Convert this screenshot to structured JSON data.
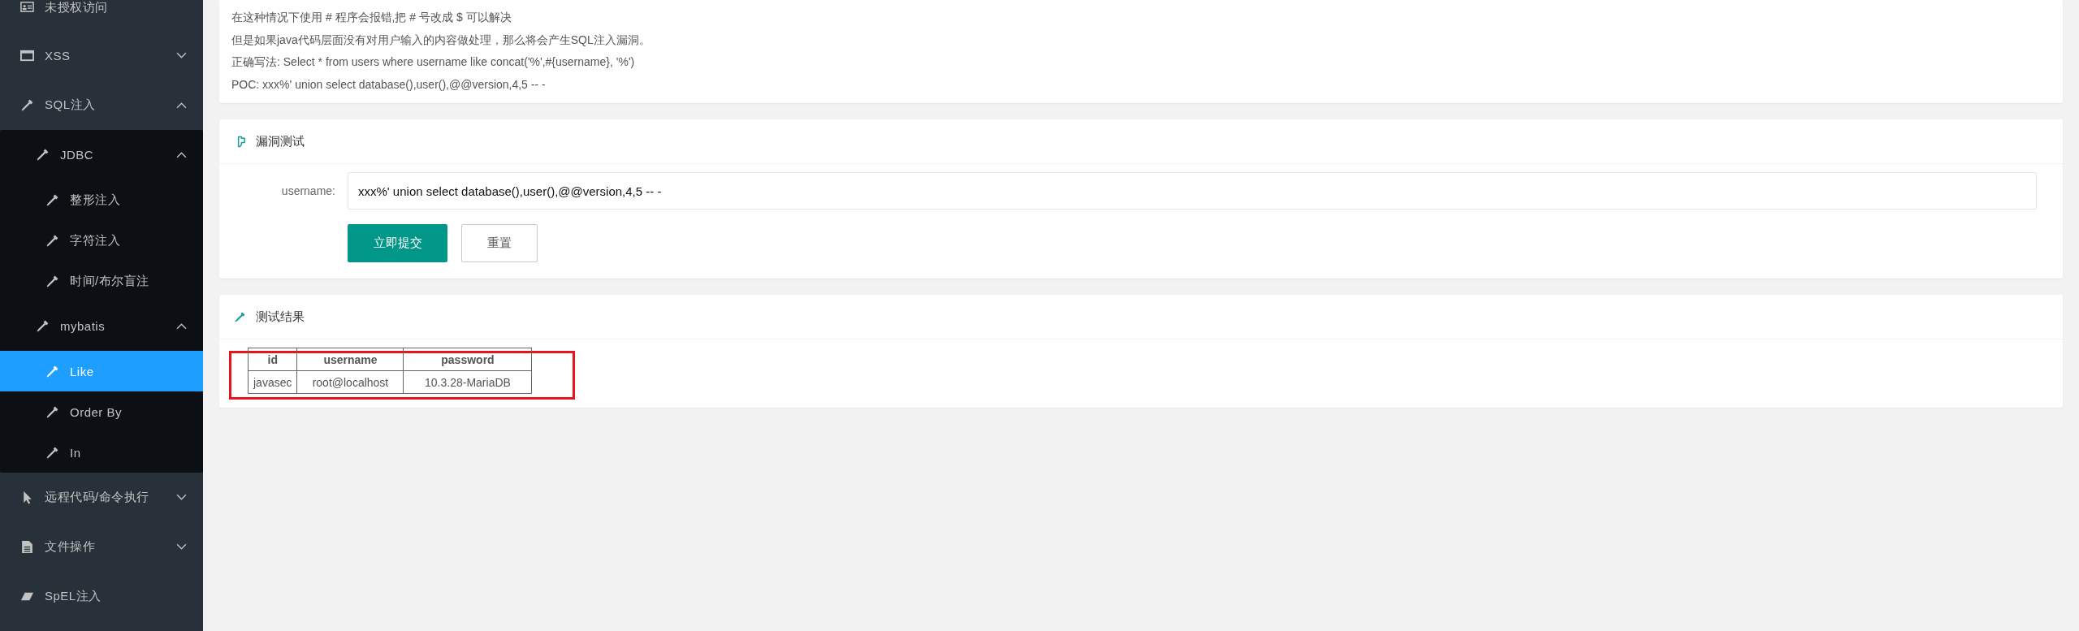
{
  "sidebar": {
    "items": [
      {
        "label": "未授权访问",
        "selected": false
      },
      {
        "label": "XSS",
        "expanded": false,
        "selected": false
      },
      {
        "label": "SQL注入",
        "expanded": true,
        "selected": false,
        "children": [
          {
            "label": "JDBC",
            "expanded": true,
            "selected": false,
            "children": [
              {
                "label": "整形注入",
                "selected": false
              },
              {
                "label": "字符注入",
                "selected": false
              },
              {
                "label": "时间/布尔盲注",
                "selected": false
              }
            ]
          },
          {
            "label": "mybatis",
            "expanded": true,
            "selected": false,
            "children": [
              {
                "label": "Like",
                "selected": true
              },
              {
                "label": "Order By",
                "selected": false
              },
              {
                "label": "In",
                "selected": false
              }
            ]
          }
        ]
      },
      {
        "label": "远程代码/命令执行",
        "expanded": false,
        "selected": false
      },
      {
        "label": "文件操作",
        "expanded": false,
        "selected": false
      },
      {
        "label": "SpEL注入",
        "selected": false
      }
    ]
  },
  "description": [
    "在这种情况下使用 # 程序会报错,把 # 号改成 $ 可以解决",
    "但是如果java代码层面没有对用户输入的内容做处理，那么将会产生SQL注入漏洞。",
    "正确写法: Select * from users where username like concat('%',#{username}, '%')",
    "POC: xxx%' union select database(),user(),@@version,4,5 -- -"
  ],
  "test_card": {
    "title": "漏洞测试",
    "field": {
      "label": "username:",
      "value": "xxx%' union select database(),user(),@@version,4,5 -- -"
    },
    "buttons": [
      {
        "label": "立即提交",
        "kind": "primary"
      },
      {
        "label": "重置",
        "kind": "plain"
      }
    ]
  },
  "result_card": {
    "title": "测试结果",
    "highlighted": true,
    "table": {
      "columns": [
        "id",
        "username",
        "password"
      ],
      "rows": [
        [
          "javasec",
          "root@localhost",
          "10.3.28-MariaDB"
        ]
      ]
    }
  }
}
